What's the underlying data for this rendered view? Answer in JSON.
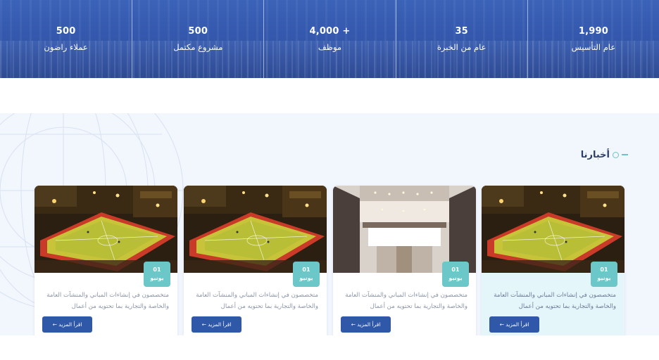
{
  "stats": [
    {
      "value": "1,990",
      "label": "عام التأسيس"
    },
    {
      "value": "35",
      "label": "عام من الخبرة"
    },
    {
      "value": "4,000 +",
      "label": "موظف"
    },
    {
      "value": "500",
      "label": "مشروع مكتمل"
    },
    {
      "value": "500",
      "label": "عملاء راضون"
    }
  ],
  "news": {
    "title": "أخبارنا",
    "accent_color": "#6cc7c9",
    "button_color": "#2f58a8",
    "cards": [
      {
        "day": "01",
        "month": "يونيو",
        "text": "متخصصون في إنشاءات المباني والمنشآت العامة والخاصة والتجارية بما تحتويه من أعمال",
        "button": "اقرأ المزيد ←",
        "image": "sports-court-night"
      },
      {
        "day": "01",
        "month": "يونيو",
        "text": "متخصصون في إنشاءات المباني والمنشآت العامة والخاصة والتجارية بما تحتويه من أعمال",
        "button": "اقرأ المزيد ←",
        "image": "building-atrium"
      },
      {
        "day": "01",
        "month": "يونيو",
        "text": "متخصصون في إنشاءات المباني والمنشآت العامة والخاصة والتجارية بما تحتويه من أعمال",
        "button": "اقرأ المزيد ←",
        "image": "sports-court-night"
      },
      {
        "day": "01",
        "month": "يونيو",
        "text": "متخصصون في إنشاءات المباني والمنشآت العامة والخاصة والتجارية بما تحتويه من أعمال",
        "button": "اقرأ المزيد ←",
        "image": "sports-court-night"
      }
    ]
  }
}
